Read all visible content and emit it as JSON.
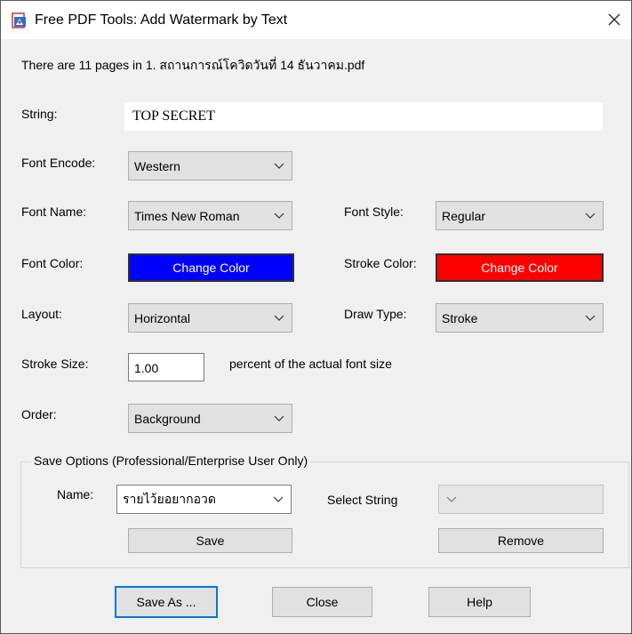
{
  "window": {
    "title": "Free PDF Tools: Add Watermark by Text",
    "icons": {
      "app": "pdf-app-icon",
      "close": "close-icon"
    }
  },
  "info": {
    "text": "There are 11 pages in 1. สถานการณ์โควิดวันที่ 14 ธันวาคม.pdf"
  },
  "form": {
    "string": {
      "label": "String:",
      "value": "TOP SECRET"
    },
    "font_encode": {
      "label": "Font Encode:",
      "value": "Western"
    },
    "font_name": {
      "label": "Font Name:",
      "value": "Times New Roman"
    },
    "font_style": {
      "label": "Font Style:",
      "value": "Regular"
    },
    "font_color": {
      "label": "Font Color:",
      "button": "Change Color",
      "color": "#0000ff"
    },
    "stroke_color": {
      "label": "Stroke Color:",
      "button": "Change Color",
      "color": "#ff0000"
    },
    "layout": {
      "label": "Layout:",
      "value": "Horizontal"
    },
    "draw_type": {
      "label": "Draw Type:",
      "value": "Stroke"
    },
    "stroke_size": {
      "label": "Stroke Size:",
      "value": "1.00",
      "suffix": "percent of the actual font size"
    },
    "order": {
      "label": "Order:",
      "value": "Background"
    }
  },
  "save_options": {
    "title": "Save Options (Professional/Enterprise User Only)",
    "name_label": "Name:",
    "name_value": "รายไว้ยอยากอวด",
    "select_string_label": "Select String",
    "select_string_value": "",
    "save_button": "Save",
    "remove_button": "Remove"
  },
  "footer": {
    "save_as": "Save As ...",
    "close": "Close",
    "help": "Help"
  }
}
